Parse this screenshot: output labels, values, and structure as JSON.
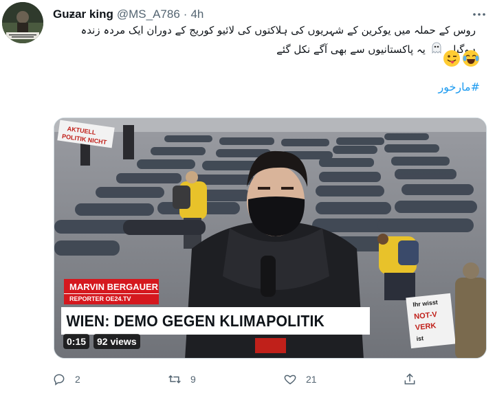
{
  "tweet": {
    "display_name": "Guƶar king",
    "handle": "@MS_A786",
    "separator": "·",
    "time": "4h",
    "text": "روس کے حملہ میں یوکرین کے شہریوں کی ہلاکتوں کی لائیو کوریج کے دوران ایک مردہ زندہ ہوگیا۔",
    "text_tail": "یہ پاکستانیوں سے بھی آگے نکل گئے",
    "emojis": [
      "ghost-emoji",
      "joy-emoji",
      "winking-tongue-emoji"
    ],
    "hashtag": "#مارخور"
  },
  "media": {
    "reporter_name": "MARVIN BERGAUER",
    "reporter_role": "REPORTER OE24.TV",
    "headline": "WIEN: DEMO GEGEN KLIMAPOLITIK",
    "duration": "0:15",
    "views": "92 views",
    "sign_left": "AKTUELL\nPOLITIK NICHT",
    "sign_right": "Ihr wisst\nNOT-V\nVERK\nist"
  },
  "actions": {
    "replies": "2",
    "retweets": "9",
    "likes": "21"
  },
  "colors": {
    "link": "#1d9bf0",
    "muted": "#536471",
    "lower_third_red": "#d5181e"
  }
}
